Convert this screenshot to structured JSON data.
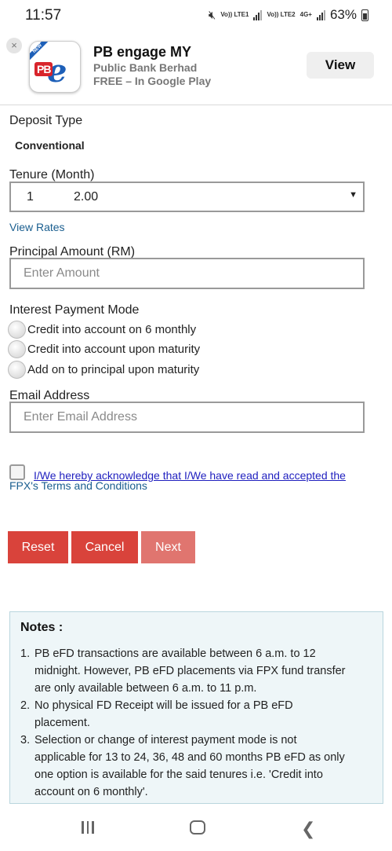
{
  "status_bar": {
    "time": "11:57",
    "sim1": "Vo)) LTE1",
    "sim2": "Vo)) LTE2",
    "net": "4G+",
    "battery": "63%"
  },
  "banner": {
    "close": "×",
    "icon_badge": "NEW",
    "icon_pb": "PB",
    "icon_e": "e",
    "app_name": "PB engage MY",
    "publisher": "Public Bank Berhad",
    "price": "FREE – In Google Play",
    "view_label": "View"
  },
  "form": {
    "deposit_type_label": "Deposit Type",
    "deposit_type_value": "Conventional",
    "tenure_label": "Tenure (Month)",
    "tenure_selected_month": "1",
    "tenure_selected_rate": "2.00",
    "caret": "▼",
    "view_rates": "View Rates",
    "principal_label": "Principal Amount (RM)",
    "principal_placeholder": "Enter Amount",
    "interest_mode_label": "Interest Payment Mode",
    "interest_options": [
      "Credit into account on 6 monthly",
      "Credit into account upon maturity",
      "Add on to principal upon maturity"
    ],
    "email_label": "Email Address",
    "email_placeholder": "Enter Email Address",
    "ack_line1": "I/We hereby acknowledge that I/We have read and accepted the",
    "ack_line2": "FPX's Terms and Conditions"
  },
  "buttons": {
    "reset": "Reset",
    "cancel": "Cancel",
    "next": "Next"
  },
  "notes": {
    "title": "Notes :",
    "items": [
      {
        "num": "1.",
        "text": "PB eFD transactions are available between 6 a.m. to 12 midnight. However, PB eFD placements via FPX fund transfer are only available between 6 a.m. to 11 p.m."
      },
      {
        "num": "2.",
        "text": "No physical FD Receipt will be issued for a PB eFD placement."
      },
      {
        "num": "3.",
        "text": "Selection or change of interest payment mode is not applicable for 13 to 24, 36, 48 and 60 months PB eFD as only one option is available for the said tenures i.e. 'Credit into account on 6 monthly'."
      }
    ]
  },
  "icons": {
    "mute": "mute-icon",
    "battery": "battery-icon",
    "recent": "recent-apps-icon",
    "home": "home-icon",
    "back": "back-icon"
  },
  "colors": {
    "button_red": "#d9433b",
    "button_disabled": "#e0756f",
    "link_blue": "#1a5e8f",
    "notes_bg": "#eef6f8"
  }
}
